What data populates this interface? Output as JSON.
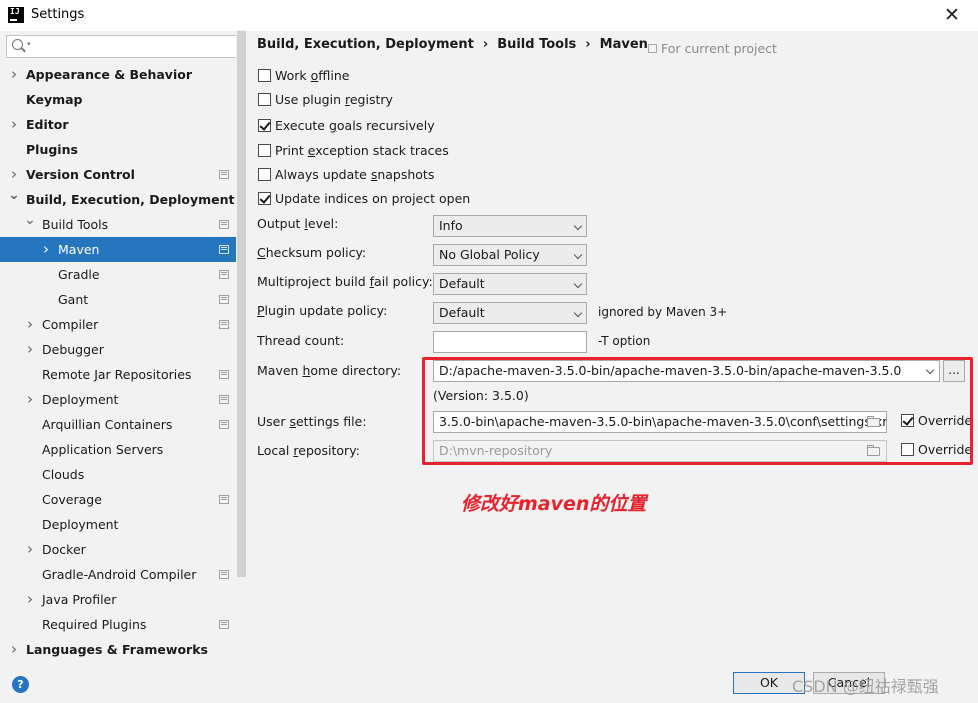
{
  "window": {
    "title": "Settings",
    "close_glyph": "✕",
    "app_icon_text": "IJ"
  },
  "sidebar": {
    "search": {
      "value": "",
      "placeholder": ""
    },
    "items": [
      {
        "label": "Appearance & Behavior",
        "level": 0,
        "bold": true,
        "arrow": "right",
        "proj": false,
        "selected": false
      },
      {
        "label": "Keymap",
        "level": 0,
        "bold": true,
        "arrow": "none",
        "proj": false,
        "selected": false
      },
      {
        "label": "Editor",
        "level": 0,
        "bold": true,
        "arrow": "right",
        "proj": false,
        "selected": false
      },
      {
        "label": "Plugins",
        "level": 0,
        "bold": true,
        "arrow": "none",
        "proj": false,
        "selected": false
      },
      {
        "label": "Version Control",
        "level": 0,
        "bold": true,
        "arrow": "right",
        "proj": true,
        "selected": false
      },
      {
        "label": "Build, Execution, Deployment",
        "level": 0,
        "bold": true,
        "arrow": "down",
        "proj": false,
        "selected": false
      },
      {
        "label": "Build Tools",
        "level": 1,
        "bold": false,
        "arrow": "down",
        "proj": true,
        "selected": false
      },
      {
        "label": "Maven",
        "level": 2,
        "bold": false,
        "arrow": "right",
        "proj": true,
        "selected": true
      },
      {
        "label": "Gradle",
        "level": 2,
        "bold": false,
        "arrow": "none",
        "proj": true,
        "selected": false
      },
      {
        "label": "Gant",
        "level": 2,
        "bold": false,
        "arrow": "none",
        "proj": true,
        "selected": false
      },
      {
        "label": "Compiler",
        "level": 1,
        "bold": false,
        "arrow": "right",
        "proj": true,
        "selected": false
      },
      {
        "label": "Debugger",
        "level": 1,
        "bold": false,
        "arrow": "right",
        "proj": false,
        "selected": false
      },
      {
        "label": "Remote Jar Repositories",
        "level": 1,
        "bold": false,
        "arrow": "none",
        "proj": true,
        "selected": false
      },
      {
        "label": "Deployment",
        "level": 1,
        "bold": false,
        "arrow": "right",
        "proj": true,
        "selected": false
      },
      {
        "label": "Arquillian Containers",
        "level": 1,
        "bold": false,
        "arrow": "none",
        "proj": true,
        "selected": false
      },
      {
        "label": "Application Servers",
        "level": 1,
        "bold": false,
        "arrow": "none",
        "proj": false,
        "selected": false
      },
      {
        "label": "Clouds",
        "level": 1,
        "bold": false,
        "arrow": "none",
        "proj": false,
        "selected": false
      },
      {
        "label": "Coverage",
        "level": 1,
        "bold": false,
        "arrow": "none",
        "proj": true,
        "selected": false
      },
      {
        "label": "Deployment",
        "level": 1,
        "bold": false,
        "arrow": "none",
        "proj": false,
        "selected": false
      },
      {
        "label": "Docker",
        "level": 1,
        "bold": false,
        "arrow": "right",
        "proj": false,
        "selected": false
      },
      {
        "label": "Gradle-Android Compiler",
        "level": 1,
        "bold": false,
        "arrow": "none",
        "proj": true,
        "selected": false
      },
      {
        "label": "Java Profiler",
        "level": 1,
        "bold": false,
        "arrow": "right",
        "proj": false,
        "selected": false
      },
      {
        "label": "Required Plugins",
        "level": 1,
        "bold": false,
        "arrow": "none",
        "proj": true,
        "selected": false
      },
      {
        "label": "Languages & Frameworks",
        "level": 0,
        "bold": true,
        "arrow": "right",
        "proj": false,
        "selected": false
      }
    ]
  },
  "breadcrumb": {
    "parts": [
      "Build, Execution, Deployment",
      "Build Tools",
      "Maven"
    ],
    "separator": "›",
    "scope_label": "For current project"
  },
  "checkboxes": [
    {
      "pre": "Work ",
      "mnemonic": "o",
      "post": "ffline",
      "checked": false
    },
    {
      "pre": "Use plugin ",
      "mnemonic": "r",
      "post": "egistry",
      "checked": false
    },
    {
      "pre": "Execute ",
      "mnemonic": "g",
      "post": "oals recursively",
      "checked": true
    },
    {
      "pre": "Print ",
      "mnemonic": "e",
      "post": "xception stack traces",
      "checked": false
    },
    {
      "pre": "Always update ",
      "mnemonic": "s",
      "post": "napshots",
      "checked": false
    },
    {
      "pre": "Update indices on project open",
      "mnemonic": "",
      "post": "",
      "checked": true
    }
  ],
  "form": {
    "output_level": {
      "pre": "Output ",
      "mnemonic": "l",
      "post": "evel:",
      "value": "Info"
    },
    "checksum_policy": {
      "pre": "",
      "mnemonic": "C",
      "post": "hecksum policy:",
      "value": "No Global Policy"
    },
    "multiproject_policy": {
      "pre": "Multiproject build ",
      "mnemonic": "f",
      "post": "ail policy:",
      "value": "Default"
    },
    "plugin_update_policy": {
      "pre": "",
      "mnemonic": "P",
      "post": "lugin update policy:",
      "value": "Default",
      "note": "ignored by Maven 3+"
    },
    "thread_count": {
      "label": "Thread count:",
      "value": "",
      "note": "-T option"
    },
    "maven_home": {
      "pre": "Maven ",
      "mnemonic": "h",
      "post": "ome directory:",
      "value": "D:/apache-maven-3.5.0-bin/apache-maven-3.5.0-bin/apache-maven-3.5.0",
      "version": "(Version: 3.5.0)",
      "browse": "..."
    },
    "user_settings": {
      "pre": "User ",
      "mnemonic": "s",
      "post": "ettings file:",
      "value": "3.5.0-bin\\apache-maven-3.5.0-bin\\apache-maven-3.5.0\\conf\\settings.xml",
      "override_label": "Override",
      "override_checked": true
    },
    "local_repo": {
      "pre": "Local ",
      "mnemonic": "r",
      "post": "epository:",
      "value": "D:\\mvn-repository",
      "override_label": "Override",
      "override_checked": false
    }
  },
  "annotation": "修改好maven的位置",
  "footer": {
    "ok": "OK",
    "cancel": "Cancel",
    "help_glyph": "?",
    "watermark": "CSDN @纽祜禄甄强"
  },
  "colors": {
    "accent": "#2675bf",
    "annotation": "#e6232e",
    "background": "#f2f2f2"
  }
}
